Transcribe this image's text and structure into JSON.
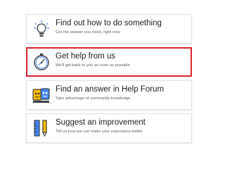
{
  "options": [
    {
      "title": "Find out how to do something",
      "subtitle": "Get the answer you need, right now",
      "icon": "lightbulb-icon"
    },
    {
      "title": "Get help from us",
      "subtitle": "We'll get back to you as soon as possible",
      "icon": "stopwatch-icon"
    },
    {
      "title": "Find an answer in Help Forum",
      "subtitle": "Take advantage of community knowledge",
      "icon": "community-faces-icon"
    },
    {
      "title": "Suggest an improvement",
      "subtitle": "Tell us how we can make your experience better",
      "icon": "pencil-ruler-icon"
    }
  ],
  "selected_index": 1,
  "colors": {
    "accent_blue": "#4285f4",
    "selection_red": "#d9262f",
    "icon_dark": "#3c4043",
    "icon_yellow": "#fbbc04"
  }
}
